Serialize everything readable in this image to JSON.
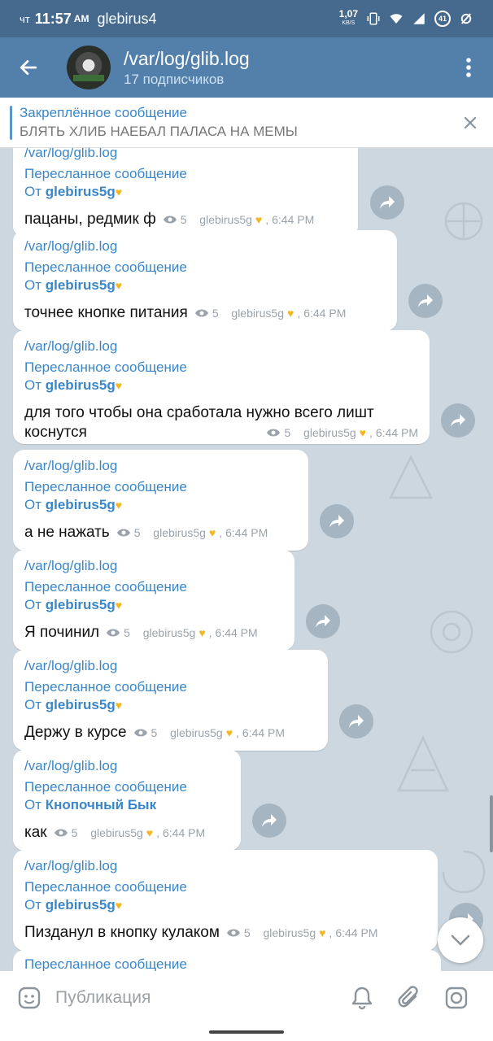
{
  "status_bar": {
    "day": "чт",
    "time": "11:57",
    "ampm": "AM",
    "carrier": "glebirus4",
    "net_speed": "1,07",
    "net_unit": "KB/S",
    "battery": "41"
  },
  "header": {
    "title": "/var/log/glib.log",
    "subtitle": "17 подписчиков"
  },
  "pinned": {
    "title": "Закреплённое сообщение",
    "message": "БЛЯТЬ ХЛИБ НАЕБАЛ ПАЛАСА НА МЕМЫ"
  },
  "messages": [
    {
      "channel": "/var/log/glib.log",
      "forwarded": "Пересланное сообщение",
      "from_prefix": "От",
      "from": "glebirus5g",
      "text": "пацаны, редмик ф",
      "views": "5",
      "author": "glebirus5g",
      "time": "6:44 PM"
    },
    {
      "channel": "/var/log/glib.log",
      "forwarded": "Пересланное сообщение",
      "from_prefix": "От",
      "from": "glebirus5g",
      "text": "точнее кнопке питания",
      "views": "5",
      "author": "glebirus5g",
      "time": "6:44 PM"
    },
    {
      "channel": "/var/log/glib.log",
      "forwarded": "Пересланное сообщение",
      "from_prefix": "От",
      "from": "glebirus5g",
      "text": "для того чтобы она сработала нужно всего лишт коснутся",
      "views": "5",
      "author": "glebirus5g",
      "time": "6:44 PM"
    },
    {
      "channel": "/var/log/glib.log",
      "forwarded": "Пересланное сообщение",
      "from_prefix": "От",
      "from": "glebirus5g",
      "text": "а не нажать",
      "views": "5",
      "author": "glebirus5g",
      "time": "6:44 PM"
    },
    {
      "channel": "/var/log/glib.log",
      "forwarded": "Пересланное сообщение",
      "from_prefix": "От",
      "from": "glebirus5g",
      "text": "Я починил",
      "views": "5",
      "author": "glebirus5g",
      "time": "6:44 PM"
    },
    {
      "channel": "/var/log/glib.log",
      "forwarded": "Пересланное сообщение",
      "from_prefix": "От",
      "from": "glebirus5g",
      "text": "Держу в курсе",
      "views": "5",
      "author": "glebirus5g",
      "time": "6:44 PM"
    },
    {
      "channel": "/var/log/glib.log",
      "forwarded": "Пересланное сообщение",
      "from_prefix": "От",
      "from": "Кнопочный Бык",
      "text": "как",
      "views": "5",
      "author": "glebirus5g",
      "time": "6:44 PM"
    },
    {
      "channel": "/var/log/glib.log",
      "forwarded": "Пересланное сообщение",
      "from_prefix": "От",
      "from": "glebirus5g",
      "text": "Пизданул в кнопку кулаком",
      "views": "5",
      "author": "glebirus5g",
      "time": "6:44 PM"
    },
    {
      "forwarded": "Пересланное сообщение"
    }
  ],
  "input": {
    "placeholder": "Публикация"
  },
  "icons": {
    "heart": "yellow-heart-icon",
    "views": "eye-icon",
    "share": "share-arrow-icon"
  },
  "colors": {
    "status_bar": "#46698e",
    "header": "#5380ab",
    "link_blue": "#3a86c8",
    "chat_bg": "#cdd7df"
  }
}
